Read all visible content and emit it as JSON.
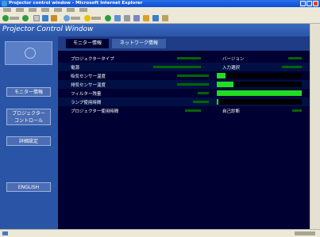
{
  "window": {
    "title": "Projector control window - Microsoft Internet Explorer"
  },
  "page_header": {
    "title": "Projector Control Window"
  },
  "sidebar": {
    "buttons": [
      {
        "label": "モニター情報"
      },
      {
        "label": "プロジェクター\nコントロール"
      },
      {
        "label": "詳細設定"
      },
      {
        "label": "ENGLISH"
      }
    ]
  },
  "tabs": [
    {
      "label": "モニター情報",
      "active": true
    },
    {
      "label": "ネットワーク情報",
      "active": false
    }
  ],
  "rows": [
    {
      "label": "プロジェクタータイプ",
      "sublabel": "バージョン",
      "meter": null
    },
    {
      "label": "電源",
      "sublabel": "入力選択",
      "meter": null
    },
    {
      "label": "吸気センサー温度",
      "sublabel": "",
      "meter": 0.1
    },
    {
      "label": "排気センサー温度",
      "sublabel": "",
      "meter": 0.2
    },
    {
      "label": "フィルター残量",
      "sublabel": "",
      "meter": 1.0
    },
    {
      "label": "ランプ使用時間",
      "sublabel": "",
      "meter": 0.02
    },
    {
      "label": "プロジェクター使用時間",
      "sublabel": "自己診断",
      "meter": null
    }
  ],
  "colors": {
    "titlebar": "#0b4fd4",
    "page_header": "#2a55a6",
    "main_bg": "#000033",
    "meter_fill": "#22dd22"
  }
}
